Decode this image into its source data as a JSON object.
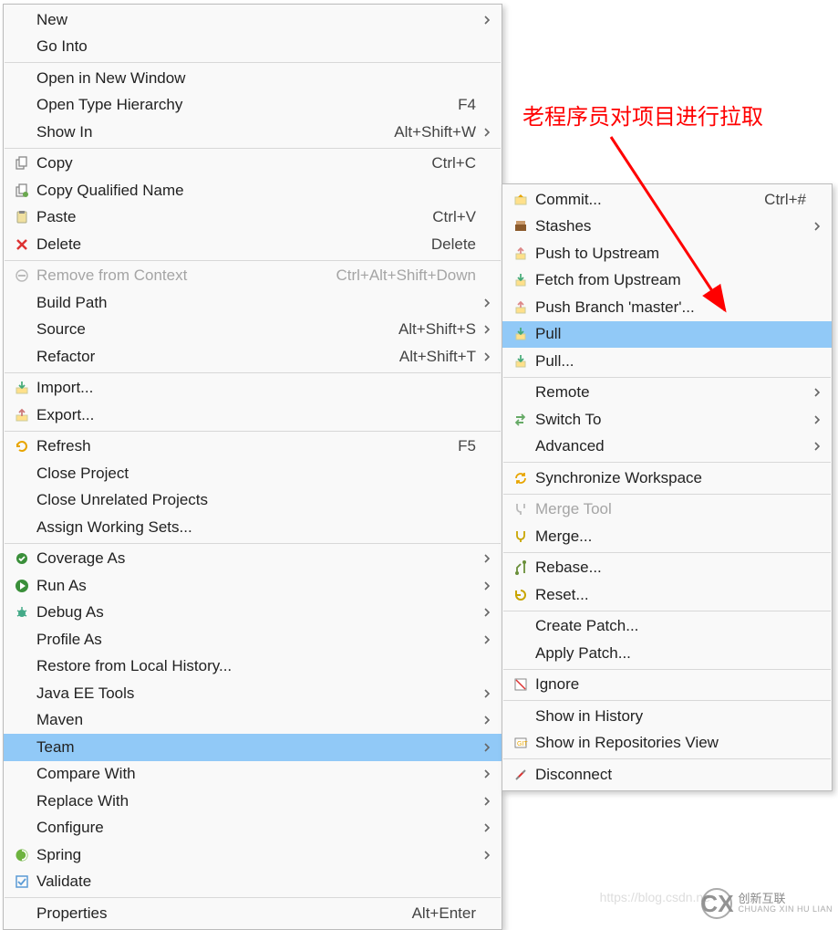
{
  "annotation_text": "老程序员对项目进行拉取",
  "main_menu": {
    "groups": [
      [
        {
          "label": "New",
          "submenu": true
        },
        {
          "label": "Go Into"
        }
      ],
      [
        {
          "label": "Open in New Window"
        },
        {
          "label": "Open Type Hierarchy",
          "shortcut": "F4"
        },
        {
          "label": "Show In",
          "shortcut": "Alt+Shift+W",
          "submenu": true
        }
      ],
      [
        {
          "label": "Copy",
          "shortcut": "Ctrl+C",
          "icon": "copy-icon"
        },
        {
          "label": "Copy Qualified Name",
          "icon": "copy-qualified-icon"
        },
        {
          "label": "Paste",
          "shortcut": "Ctrl+V",
          "icon": "paste-icon"
        },
        {
          "label": "Delete",
          "shortcut": "Delete",
          "icon": "delete-icon"
        }
      ],
      [
        {
          "label": "Remove from Context",
          "shortcut": "Ctrl+Alt+Shift+Down",
          "icon": "remove-context-icon",
          "disabled": true
        },
        {
          "label": "Build Path",
          "submenu": true
        },
        {
          "label": "Source",
          "shortcut": "Alt+Shift+S",
          "submenu": true
        },
        {
          "label": "Refactor",
          "shortcut": "Alt+Shift+T",
          "submenu": true
        }
      ],
      [
        {
          "label": "Import...",
          "icon": "import-icon"
        },
        {
          "label": "Export...",
          "icon": "export-icon"
        }
      ],
      [
        {
          "label": "Refresh",
          "shortcut": "F5",
          "icon": "refresh-icon"
        },
        {
          "label": "Close Project"
        },
        {
          "label": "Close Unrelated Projects"
        },
        {
          "label": "Assign Working Sets..."
        }
      ],
      [
        {
          "label": "Coverage As",
          "submenu": true,
          "icon": "coverage-icon"
        },
        {
          "label": "Run As",
          "submenu": true,
          "icon": "run-icon"
        },
        {
          "label": "Debug As",
          "submenu": true,
          "icon": "debug-icon"
        },
        {
          "label": "Profile As",
          "submenu": true
        },
        {
          "label": "Restore from Local History..."
        },
        {
          "label": "Java EE Tools",
          "submenu": true
        },
        {
          "label": "Maven",
          "submenu": true
        },
        {
          "label": "Team",
          "submenu": true,
          "selected": true
        },
        {
          "label": "Compare With",
          "submenu": true
        },
        {
          "label": "Replace With",
          "submenu": true
        },
        {
          "label": "Configure",
          "submenu": true
        },
        {
          "label": "Spring",
          "submenu": true,
          "icon": "spring-icon"
        },
        {
          "label": "Validate",
          "icon": "validate-icon"
        }
      ],
      [
        {
          "label": "Properties",
          "shortcut": "Alt+Enter"
        }
      ]
    ]
  },
  "sub_menu": {
    "groups": [
      [
        {
          "label": "Commit...",
          "shortcut": "Ctrl+#",
          "icon": "commit-icon"
        },
        {
          "label": "Stashes",
          "submenu": true,
          "icon": "stash-icon"
        },
        {
          "label": "Push to Upstream",
          "icon": "push-upstream-icon"
        },
        {
          "label": "Fetch from Upstream",
          "icon": "fetch-upstream-icon"
        },
        {
          "label": "Push Branch 'master'...",
          "icon": "push-branch-icon"
        },
        {
          "label": "Pull",
          "icon": "pull-icon",
          "selected": true
        },
        {
          "label": "Pull...",
          "icon": "pull-dialog-icon"
        }
      ],
      [
        {
          "label": "Remote",
          "submenu": true
        },
        {
          "label": "Switch To",
          "submenu": true,
          "icon": "switch-to-icon"
        },
        {
          "label": "Advanced",
          "submenu": true
        }
      ],
      [
        {
          "label": "Synchronize Workspace",
          "icon": "sync-icon"
        }
      ],
      [
        {
          "label": "Merge Tool",
          "icon": "merge-tool-icon",
          "disabled": true
        },
        {
          "label": "Merge...",
          "icon": "merge-icon"
        }
      ],
      [
        {
          "label": "Rebase...",
          "icon": "rebase-icon"
        },
        {
          "label": "Reset...",
          "icon": "reset-icon"
        }
      ],
      [
        {
          "label": "Create Patch..."
        },
        {
          "label": "Apply Patch..."
        }
      ],
      [
        {
          "label": "Ignore",
          "icon": "ignore-icon"
        }
      ],
      [
        {
          "label": "Show in History"
        },
        {
          "label": "Show in Repositories View",
          "icon": "repos-view-icon"
        }
      ],
      [
        {
          "label": "Disconnect",
          "icon": "disconnect-icon"
        }
      ]
    ]
  },
  "watermark": {
    "brand": "创新互联",
    "en": "CHUANG XIN HU LIAN",
    "logo": "CX"
  },
  "faint_url": "https://blog.csdn.ne"
}
